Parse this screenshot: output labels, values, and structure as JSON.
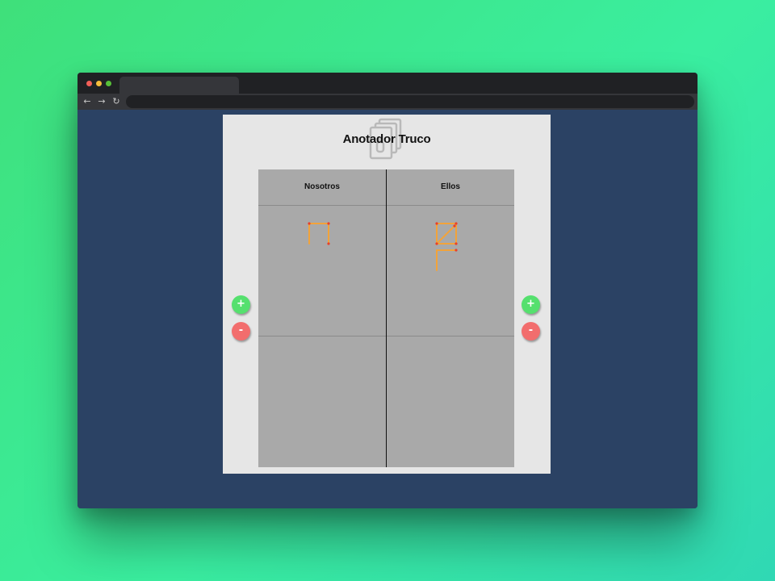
{
  "app": {
    "title": "Anotador Truco",
    "logo_icon": "cards-icon"
  },
  "scoreboard": {
    "teams": [
      {
        "name": "Nosotros",
        "points": 3
      },
      {
        "name": "Ellos",
        "points": 7
      }
    ]
  },
  "controls": {
    "plus_label": "+",
    "minus_label": "-"
  },
  "colors": {
    "page_background": "#2b4264",
    "panel": "#e6e6e6",
    "board": "#a9a9a9",
    "plus_button": "#55e06e",
    "minus_button": "#f26d6d",
    "matchstick": "#f2a33a",
    "match_head": "#e8402a"
  },
  "browser": {
    "nav_icons": [
      "back-arrow-icon",
      "forward-arrow-icon",
      "reload-icon"
    ]
  }
}
